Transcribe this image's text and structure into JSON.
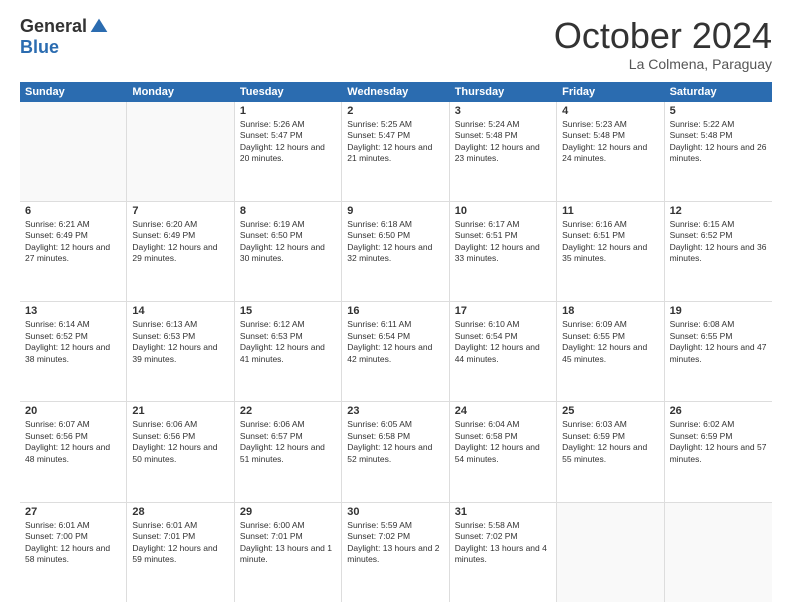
{
  "logo": {
    "general": "General",
    "blue": "Blue"
  },
  "header": {
    "month": "October 2024",
    "location": "La Colmena, Paraguay"
  },
  "weekdays": [
    "Sunday",
    "Monday",
    "Tuesday",
    "Wednesday",
    "Thursday",
    "Friday",
    "Saturday"
  ],
  "rows": [
    [
      {
        "day": "",
        "text": ""
      },
      {
        "day": "",
        "text": ""
      },
      {
        "day": "1",
        "text": "Sunrise: 5:26 AM\nSunset: 5:47 PM\nDaylight: 12 hours and 20 minutes."
      },
      {
        "day": "2",
        "text": "Sunrise: 5:25 AM\nSunset: 5:47 PM\nDaylight: 12 hours and 21 minutes."
      },
      {
        "day": "3",
        "text": "Sunrise: 5:24 AM\nSunset: 5:48 PM\nDaylight: 12 hours and 23 minutes."
      },
      {
        "day": "4",
        "text": "Sunrise: 5:23 AM\nSunset: 5:48 PM\nDaylight: 12 hours and 24 minutes."
      },
      {
        "day": "5",
        "text": "Sunrise: 5:22 AM\nSunset: 5:48 PM\nDaylight: 12 hours and 26 minutes."
      }
    ],
    [
      {
        "day": "6",
        "text": "Sunrise: 6:21 AM\nSunset: 6:49 PM\nDaylight: 12 hours and 27 minutes."
      },
      {
        "day": "7",
        "text": "Sunrise: 6:20 AM\nSunset: 6:49 PM\nDaylight: 12 hours and 29 minutes."
      },
      {
        "day": "8",
        "text": "Sunrise: 6:19 AM\nSunset: 6:50 PM\nDaylight: 12 hours and 30 minutes."
      },
      {
        "day": "9",
        "text": "Sunrise: 6:18 AM\nSunset: 6:50 PM\nDaylight: 12 hours and 32 minutes."
      },
      {
        "day": "10",
        "text": "Sunrise: 6:17 AM\nSunset: 6:51 PM\nDaylight: 12 hours and 33 minutes."
      },
      {
        "day": "11",
        "text": "Sunrise: 6:16 AM\nSunset: 6:51 PM\nDaylight: 12 hours and 35 minutes."
      },
      {
        "day": "12",
        "text": "Sunrise: 6:15 AM\nSunset: 6:52 PM\nDaylight: 12 hours and 36 minutes."
      }
    ],
    [
      {
        "day": "13",
        "text": "Sunrise: 6:14 AM\nSunset: 6:52 PM\nDaylight: 12 hours and 38 minutes."
      },
      {
        "day": "14",
        "text": "Sunrise: 6:13 AM\nSunset: 6:53 PM\nDaylight: 12 hours and 39 minutes."
      },
      {
        "day": "15",
        "text": "Sunrise: 6:12 AM\nSunset: 6:53 PM\nDaylight: 12 hours and 41 minutes."
      },
      {
        "day": "16",
        "text": "Sunrise: 6:11 AM\nSunset: 6:54 PM\nDaylight: 12 hours and 42 minutes."
      },
      {
        "day": "17",
        "text": "Sunrise: 6:10 AM\nSunset: 6:54 PM\nDaylight: 12 hours and 44 minutes."
      },
      {
        "day": "18",
        "text": "Sunrise: 6:09 AM\nSunset: 6:55 PM\nDaylight: 12 hours and 45 minutes."
      },
      {
        "day": "19",
        "text": "Sunrise: 6:08 AM\nSunset: 6:55 PM\nDaylight: 12 hours and 47 minutes."
      }
    ],
    [
      {
        "day": "20",
        "text": "Sunrise: 6:07 AM\nSunset: 6:56 PM\nDaylight: 12 hours and 48 minutes."
      },
      {
        "day": "21",
        "text": "Sunrise: 6:06 AM\nSunset: 6:56 PM\nDaylight: 12 hours and 50 minutes."
      },
      {
        "day": "22",
        "text": "Sunrise: 6:06 AM\nSunset: 6:57 PM\nDaylight: 12 hours and 51 minutes."
      },
      {
        "day": "23",
        "text": "Sunrise: 6:05 AM\nSunset: 6:58 PM\nDaylight: 12 hours and 52 minutes."
      },
      {
        "day": "24",
        "text": "Sunrise: 6:04 AM\nSunset: 6:58 PM\nDaylight: 12 hours and 54 minutes."
      },
      {
        "day": "25",
        "text": "Sunrise: 6:03 AM\nSunset: 6:59 PM\nDaylight: 12 hours and 55 minutes."
      },
      {
        "day": "26",
        "text": "Sunrise: 6:02 AM\nSunset: 6:59 PM\nDaylight: 12 hours and 57 minutes."
      }
    ],
    [
      {
        "day": "27",
        "text": "Sunrise: 6:01 AM\nSunset: 7:00 PM\nDaylight: 12 hours and 58 minutes."
      },
      {
        "day": "28",
        "text": "Sunrise: 6:01 AM\nSunset: 7:01 PM\nDaylight: 12 hours and 59 minutes."
      },
      {
        "day": "29",
        "text": "Sunrise: 6:00 AM\nSunset: 7:01 PM\nDaylight: 13 hours and 1 minute."
      },
      {
        "day": "30",
        "text": "Sunrise: 5:59 AM\nSunset: 7:02 PM\nDaylight: 13 hours and 2 minutes."
      },
      {
        "day": "31",
        "text": "Sunrise: 5:58 AM\nSunset: 7:02 PM\nDaylight: 13 hours and 4 minutes."
      },
      {
        "day": "",
        "text": ""
      },
      {
        "day": "",
        "text": ""
      }
    ]
  ]
}
